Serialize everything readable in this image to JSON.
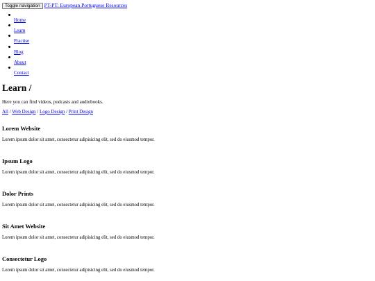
{
  "header": {
    "toggle_label": "Toggle navigation",
    "brand": "PT-PT: European Portuguese Resources"
  },
  "nav": {
    "items": [
      {
        "label": "Home"
      },
      {
        "label": "Learn"
      },
      {
        "label": "Practise"
      },
      {
        "label": "Blog"
      },
      {
        "label": "About"
      },
      {
        "label": "Contact"
      }
    ]
  },
  "main": {
    "title": "Learn /",
    "intro": "Here you can find videos, podcasts and audiobooks.",
    "filters": [
      {
        "label": "All"
      },
      {
        "label": "Web Design"
      },
      {
        "label": "Logo Design"
      },
      {
        "label": "Print Design"
      }
    ],
    "filter_separator": " / ",
    "projects": [
      {
        "title": "Lorem Website",
        "description": "Lorem ipsum dolor sit amet, consectetur adipisicing elit, sed do eiusmod tempor."
      },
      {
        "title": "Ipsum Logo",
        "description": "Lorem ipsum dolor sit amet, consectetur adipisicing elit, sed do eiusmod tempor."
      },
      {
        "title": "Dolor Prints",
        "description": "Lorem ipsum dolor sit amet, consectetur adipisicing elit, sed do eiusmod tempor."
      },
      {
        "title": "Sit Amet Website",
        "description": "Lorem ipsum dolor sit amet, consectetur adipisicing elit, sed do eiusmod tempor."
      },
      {
        "title": "Consectetur Logo",
        "description": "Lorem ipsum dolor sit amet, consectetur adipisicing elit, sed do eiusmod tempor."
      }
    ]
  }
}
